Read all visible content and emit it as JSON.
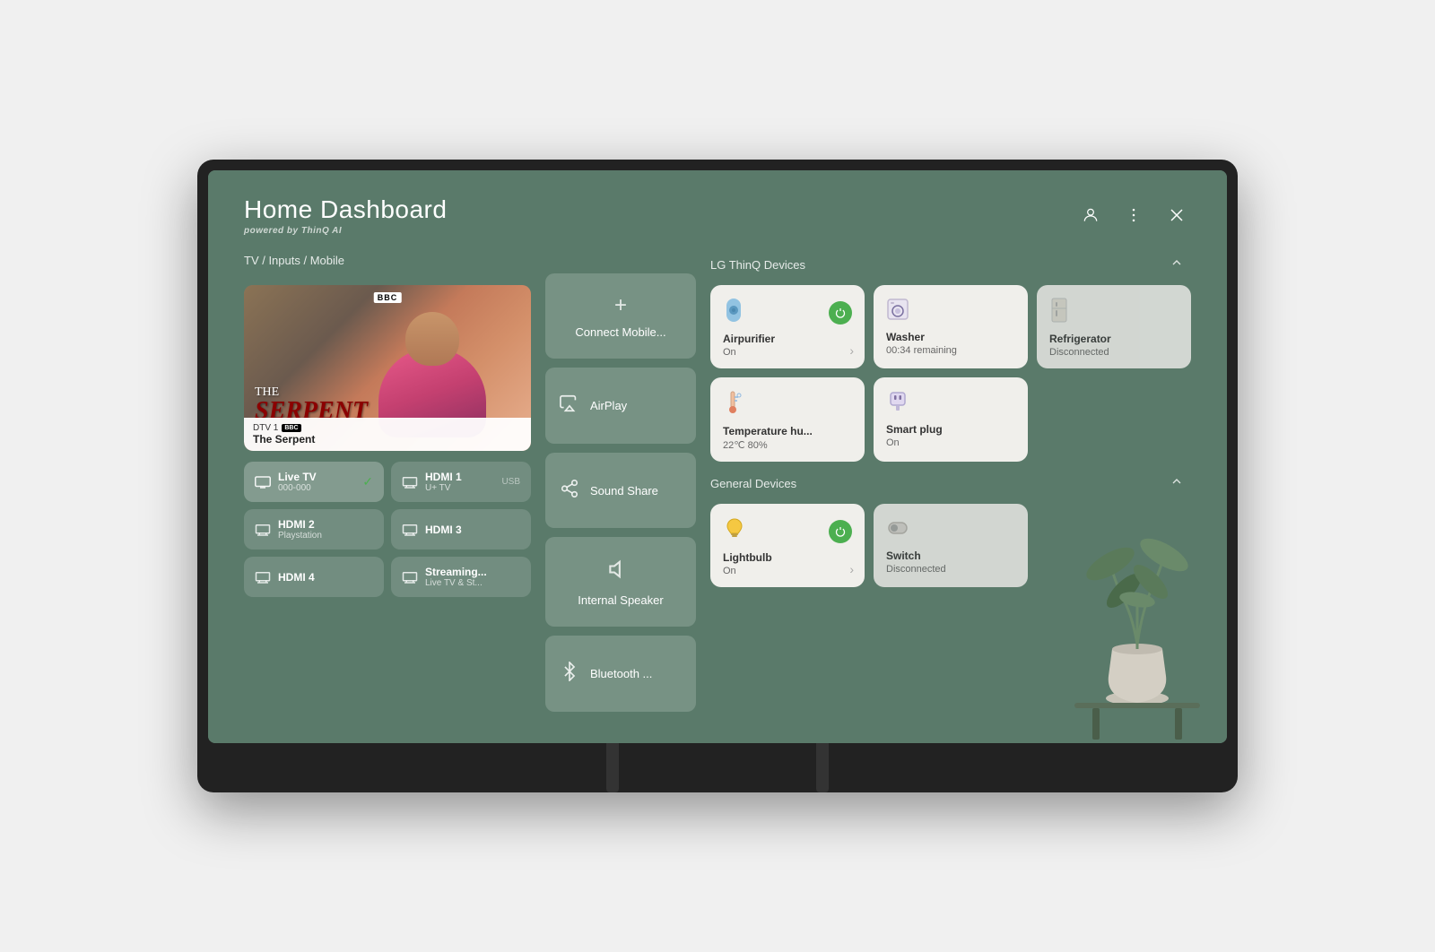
{
  "header": {
    "title": "Home Dashboard",
    "subtitle": "powered by",
    "subtitle_brand": "ThinQ AI",
    "icon_profile": "👤",
    "icon_more": "⋮",
    "icon_close": "✕"
  },
  "tv_section": {
    "label": "TV / Inputs / Mobile",
    "channel": "DTV 1",
    "show": "The Serpent",
    "show_title_main": "The Serpent",
    "show_title_the": "The"
  },
  "inputs": [
    {
      "name": "Live TV",
      "sub": "000-000",
      "active": true,
      "icon": "📺"
    },
    {
      "name": "HDMI 1",
      "sub": "U+ TV",
      "active": false,
      "icon": "📡"
    },
    {
      "name": "HDMI 2",
      "sub": "Playstation",
      "active": false,
      "icon": "📡"
    },
    {
      "name": "HDMI 3",
      "sub": "",
      "active": false,
      "icon": "📡"
    },
    {
      "name": "HDMI 4",
      "sub": "",
      "active": false,
      "icon": "📡"
    },
    {
      "name": "Streaming...",
      "sub": "Live TV & St...",
      "active": false,
      "icon": "📡"
    }
  ],
  "mobile_cards": [
    {
      "id": "connect-mobile",
      "label": "Connect Mobile...",
      "icon": "+"
    },
    {
      "id": "airplay",
      "label": "AirPlay",
      "icon": "airplay"
    },
    {
      "id": "sound-share",
      "label": "Sound Share",
      "icon": "sound-share"
    },
    {
      "id": "internal-speaker",
      "label": "Internal Speaker",
      "icon": "speaker"
    },
    {
      "id": "bluetooth",
      "label": "Bluetooth ...",
      "icon": "bluetooth"
    }
  ],
  "thinq_section": {
    "label": "LG ThinQ Devices",
    "devices": [
      {
        "id": "airpurifier",
        "name": "Airpurifier",
        "status": "On",
        "icon": "🌀",
        "power": "on",
        "has_arrow": true
      },
      {
        "id": "washer",
        "name": "Washer",
        "status": "00:34 remaining",
        "icon": "🫧",
        "power": "on",
        "has_arrow": false
      },
      {
        "id": "refrigerator",
        "name": "Refrigerator",
        "status": "Disconnected",
        "icon": "🧊",
        "power": "off",
        "has_arrow": false
      },
      {
        "id": "temp-humidity",
        "name": "Temperature hu...",
        "status": "22℃ 80%",
        "icon": "🌡️",
        "power": "none",
        "has_arrow": false
      },
      {
        "id": "smart-plug",
        "name": "Smart plug",
        "status": "On",
        "icon": "🔌",
        "power": "none",
        "has_arrow": false
      }
    ]
  },
  "general_section": {
    "label": "General Devices",
    "devices": [
      {
        "id": "lightbulb",
        "name": "Lightbulb",
        "status": "On",
        "icon": "💡",
        "power": "on",
        "has_arrow": true
      },
      {
        "id": "switch",
        "name": "Switch",
        "status": "Disconnected",
        "icon": "🔘",
        "power": "off",
        "has_arrow": false
      }
    ]
  }
}
